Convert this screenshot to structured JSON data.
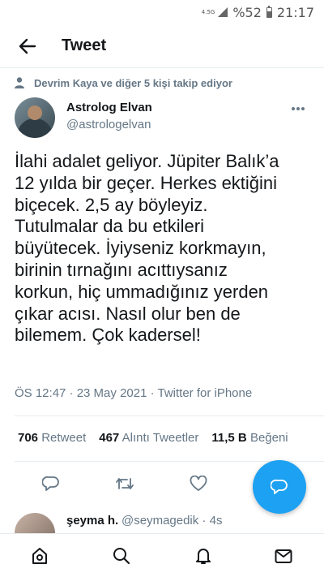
{
  "status_bar": {
    "network": "4.5G",
    "battery": "%52",
    "time": "21:17"
  },
  "header": {
    "title": "Tweet",
    "back_icon": "arrow-left-icon"
  },
  "social_context": {
    "text": "Devrim Kaya ve diğer 5 kişi takip ediyor",
    "icon": "person-icon"
  },
  "tweet": {
    "author_name": "Astrolog Elvan",
    "author_handle": "@astrologelvan",
    "text_lines": [
      "İlahi adalet geliyor. Jüpiter Balık’a",
      "12 yılda bir geçer. Herkes ektiğini",
      "biçecek. 2,5 ay böyleyiz.",
      "Tutulmalar da bu etkileri",
      "büyütecek. İyiyseniz korkmayın,",
      "birinin tırnağını acıttıysanız",
      "korkun, hiç ummadığınız yerden",
      "çıkar acısı. Nasıl olur ben de",
      "bilemem. Çok kadersel!"
    ],
    "meta": "ÖS 12:47 · 23 May 2021 · Twitter for iPhone",
    "stats": {
      "retweets_count": "706",
      "retweets_label": "Retweet",
      "quotes_count": "467",
      "quotes_label": "Alıntı Tweetler",
      "likes_count": "11,5 B",
      "likes_label": "Beğeni"
    }
  },
  "reply": {
    "name": "şeyma h.",
    "handle": "@seymagedik · 4s"
  },
  "colors": {
    "accent": "#1da1f2",
    "secondary_text": "#657786",
    "primary_text": "#14171a",
    "divider": "#e6ecf0"
  },
  "nav_icons": [
    "home-icon",
    "search-icon",
    "notifications-icon",
    "messages-icon"
  ]
}
